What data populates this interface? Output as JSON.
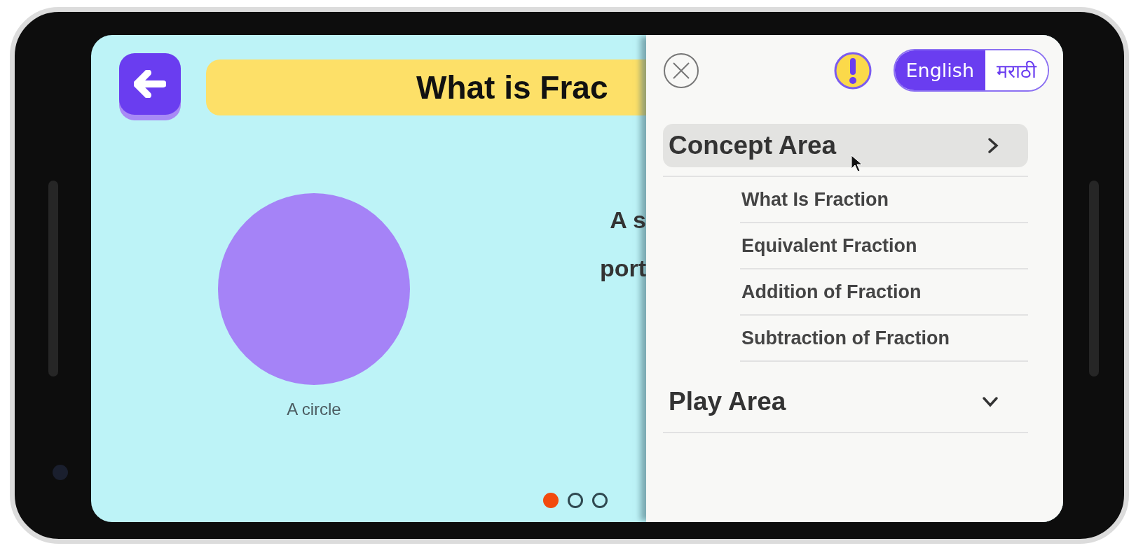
{
  "header": {
    "title": "What is Frac"
  },
  "slide": {
    "caption": "A circle",
    "text_lines": [
      "A s",
      "port"
    ]
  },
  "pager": [
    {
      "selected": true
    },
    {
      "selected": false
    },
    {
      "selected": false
    }
  ],
  "drawer": {
    "languages": [
      {
        "label": "English",
        "selected": true
      },
      {
        "label": "मराठी",
        "selected": false
      }
    ],
    "sections": [
      {
        "label": "Concept Area",
        "highlighted": true,
        "kind": "link",
        "items": [
          "What Is Fraction",
          "Equivalent Fraction",
          "Addition of Fraction",
          "Subtraction of Fraction"
        ]
      },
      {
        "label": "Play Area",
        "highlighted": false,
        "kind": "dropdown"
      }
    ]
  }
}
